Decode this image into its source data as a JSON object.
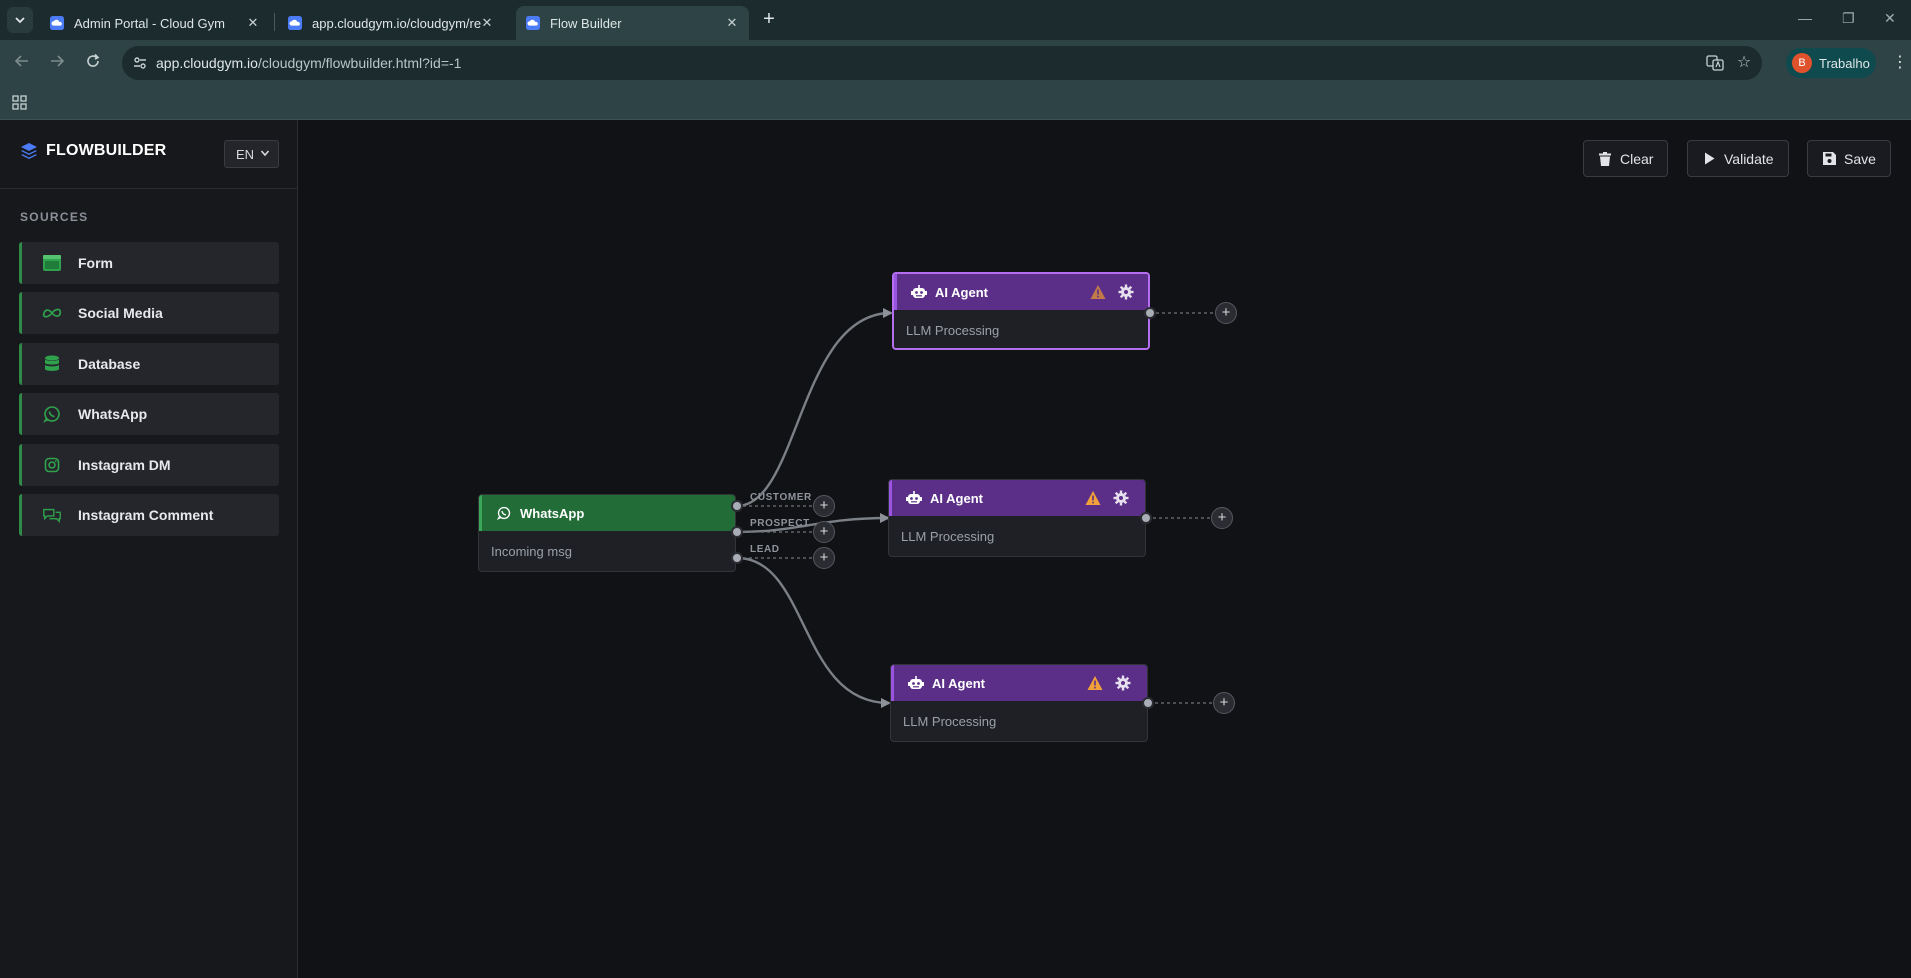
{
  "browser": {
    "tabs": [
      {
        "title": "Admin Portal - Cloud Gym",
        "active": false
      },
      {
        "title": "app.cloudgym.io/cloudgym/rep",
        "active": false
      },
      {
        "title": "Flow Builder",
        "active": true
      }
    ],
    "url_host": "app.cloudgym.io",
    "url_path": "/cloudgym/flowbuilder.html?id=-1",
    "profile": {
      "initial": "B",
      "name": "Trabalho"
    }
  },
  "sidebar": {
    "brand": "FLOWBUILDER",
    "language": "EN",
    "section_label": "SOURCES",
    "items": [
      {
        "label": "Form",
        "icon": "form-icon"
      },
      {
        "label": "Social Media",
        "icon": "meta-icon"
      },
      {
        "label": "Database",
        "icon": "database-icon"
      },
      {
        "label": "WhatsApp",
        "icon": "whatsapp-icon"
      },
      {
        "label": "Instagram DM",
        "icon": "instagram-icon"
      },
      {
        "label": "Instagram Comment",
        "icon": "comments-icon"
      }
    ]
  },
  "toolbar": {
    "clear_label": "Clear",
    "validate_label": "Validate",
    "save_label": "Save"
  },
  "nodes": {
    "whatsapp": {
      "title": "WhatsApp",
      "body": "Incoming msg"
    },
    "agent1": {
      "title": "AI Agent",
      "body": "LLM Processing"
    },
    "agent2": {
      "title": "AI Agent",
      "body": "LLM Processing"
    },
    "agent3": {
      "title": "AI Agent",
      "body": "LLM Processing"
    }
  },
  "branches": [
    "CUSTOMER",
    "PROSPECT",
    "LEAD"
  ],
  "colors": {
    "whatsapp_green": "#216c37",
    "agent_purple": "#5b2f88",
    "selected_border": "#b56ef0",
    "warning": "#f2a13a"
  }
}
